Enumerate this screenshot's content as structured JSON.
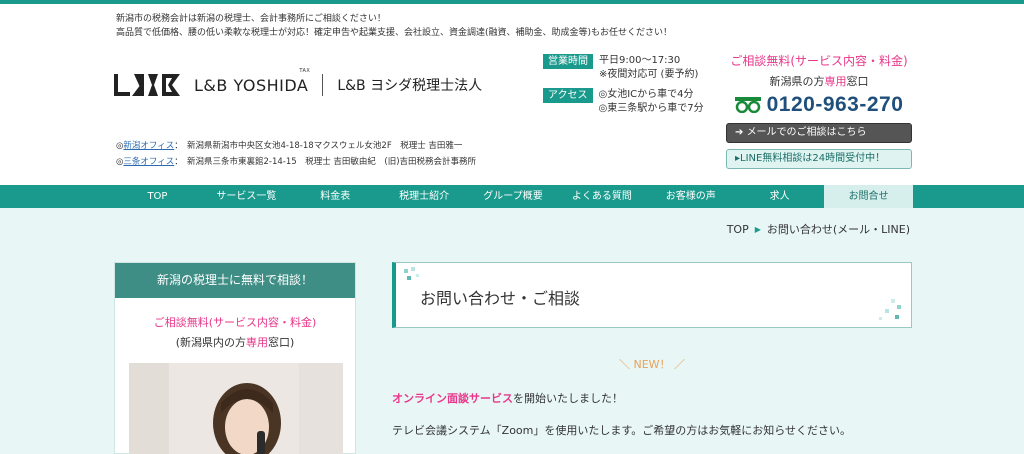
{
  "header": {
    "tagline_line1": "新潟市の税務会計は新潟の税理士、会計事務所にご相談ください！",
    "tagline_line2": "高品質で低価格、腰の低い柔軟な税理士が対応！確定申告や起業支援、会社設立、資金調達(融資、補助金、助成金等)もお任せください！",
    "logo_en": "L&B YOSHIDA",
    "logo_tax": "TAX",
    "logo_jp": "L&B ヨシダ税理士法人",
    "office1_link": "新潟オフィス",
    "office1_text": "：　新潟県新潟市中央区女池4-18-18マクスウェル女池2F　税理士 吉田雅一",
    "office2_link": "三条オフィス",
    "office2_text": "：　新潟県三条市東裏館2-14-15　税理士 吉田敏由紀　(旧)吉田税務会計事務所"
  },
  "info": {
    "hours_label": "営業時間",
    "hours_line1": "平日9:00〜17:30",
    "hours_line2": "※夜間対応可 (要予約)",
    "access_label": "アクセス",
    "access_line1": "◎女池ICから車で4分",
    "access_line2": "◎東三条駅から車で7分"
  },
  "contact": {
    "title": "ご相談無料(サービス内容・料金)",
    "sub_pre": "新潟県の方",
    "sub_pink": "専用",
    "sub_post": "窓口",
    "phone": "0120-963-270",
    "mail_button": "メールでのご相談はこちら",
    "line_button": "LINE無料相談は24時間受付中！"
  },
  "nav": {
    "items": [
      "TOP",
      "サービス一覧",
      "料金表",
      "税理士紹介",
      "グループ概要",
      "よくある質問",
      "お客様の声",
      "求人",
      "お問合せ"
    ]
  },
  "breadcrumb": {
    "home": "TOP",
    "current": "お問い合わせ(メール・LINE)"
  },
  "sidebar": {
    "heading": "新潟の税理士に無料で相談！",
    "pink_line": "ご相談無料(サービス内容・料金)",
    "sub_pre": "(新潟県内の方",
    "sub_pink": "専用",
    "sub_post": "窓口)"
  },
  "content": {
    "title": "お問い合わせ・ご相談",
    "new_label": "＼ NEW！ ／",
    "p1_pink": "オンライン面談サービス",
    "p1_rest": "を開始いたしました！",
    "p2": "テレビ会議システム「Zoom」を使用いたします。ご希望の方はお気軽にお知らせください。"
  },
  "colors": {
    "brand_teal": "#1a9a8c",
    "accent_pink": "#e8378a",
    "phone_blue": "#1f4f7a",
    "background_mint": "#e8f7f6"
  }
}
